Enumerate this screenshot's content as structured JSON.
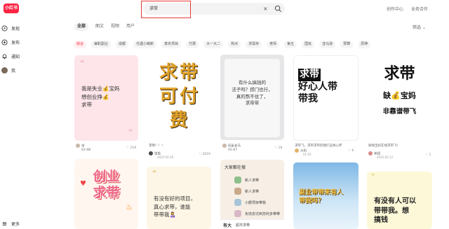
{
  "header": {
    "logo": "小红书",
    "search_value": "求带",
    "clear_icon": "×",
    "links": [
      "创作中心",
      "业务合作"
    ]
  },
  "sidebar": {
    "items": [
      {
        "label": "发现",
        "icon": "compass-icon"
      },
      {
        "label": "发布",
        "icon": "plus-icon"
      },
      {
        "label": "通知",
        "icon": "bell-icon"
      },
      {
        "label": "我",
        "icon": "avatar"
      }
    ],
    "more": "更多"
  },
  "tabs": [
    "全部",
    "图文",
    "视频",
    "用户"
  ],
  "filter": "筛选",
  "chips": [
    "综合",
    "兼职副业",
    "成都",
    "光遇小萌新",
    "真实项目",
    "付费",
    "大一大二",
    "热点",
    "求需存",
    "老师",
    "第五",
    "国玩",
    "亚马逊",
    "预算",
    "原神"
  ],
  "cards": [
    {
      "text": [
        "我是失业💰宝妈",
        "想创业挣💰",
        "求带"
      ],
      "author": "带",
      "date": "01-08",
      "likes": "218"
    },
    {
      "text": [
        "求带",
        "可付费"
      ],
      "author": "李明！！！",
      "author2": "笛笛",
      "date": "2025-02-26",
      "likes": "2019"
    },
    {
      "text": [
        "有什么搞钱的",
        "法子吗？捞门也行，",
        "真的熬不住了，",
        "求带带"
      ],
      "author": "阿卧老马",
      "date": "01-07",
      "likes": "18"
    },
    {
      "text": [
        "求带",
        "好心人带",
        "带我"
      ],
      "author": "求带飞，求带求带的我们这样心怀",
      "author2": "大阳",
      "date": "01-05",
      "likes": "6"
    },
    {
      "text": [
        "求带",
        "缺💰宝妈",
        "非靠谱带飞"
      ],
      "author": "缺钱宝妈在线求带飞！",
      "author2": "美妞",
      "date": "2025-02-12",
      "likes": "1"
    },
    {
      "text": [
        "创业",
        "求带"
      ]
    },
    {
      "text": [
        "有没有好的项目，",
        "真心求带，谁能",
        "带带我👩‍🍼"
      ]
    },
    {
      "title": "大家都在搜",
      "items": [
        "新人求带",
        "新人求带",
        "小额项目带我",
        "兼职求带",
        "负债去坑到苏利多带带"
      ],
      "footer_text": "有大",
      "footer_sub": "超市求带"
    },
    {
      "text": [
        "副业带带来有人",
        "带我吗？"
      ]
    },
    {
      "text": [
        "有没有人可以",
        "带带我。想",
        "搞钱"
      ]
    }
  ]
}
